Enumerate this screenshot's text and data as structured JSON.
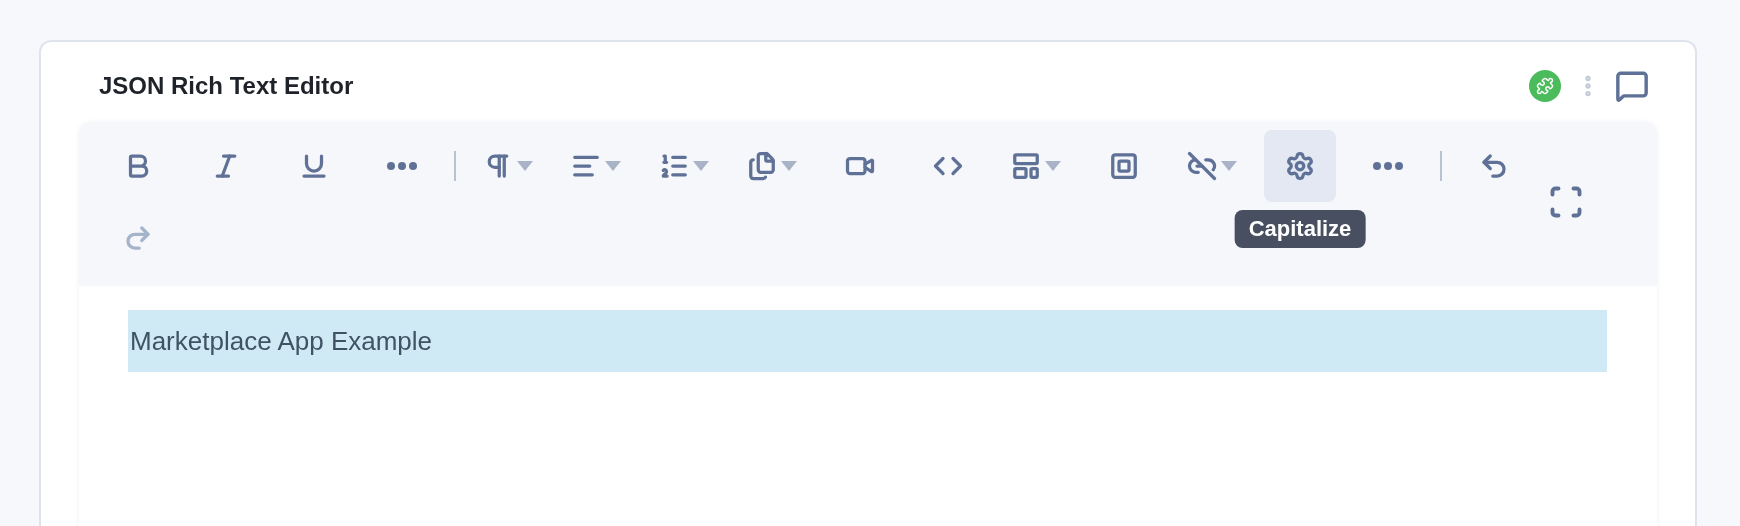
{
  "card": {
    "title": "JSON Rich Text Editor"
  },
  "header_actions": [
    {
      "kind": "status",
      "color": "#4cbb5c"
    },
    {
      "kind": "menu"
    },
    {
      "kind": "comment"
    }
  ],
  "toolbar": {
    "items": [
      {
        "kind": "button",
        "dropdown": false,
        "disabled": false,
        "hovered": false
      },
      {
        "kind": "button",
        "dropdown": false,
        "disabled": false,
        "hovered": false
      },
      {
        "kind": "button",
        "dropdown": false,
        "disabled": false,
        "hovered": false
      },
      {
        "kind": "button",
        "dropdown": false,
        "disabled": false,
        "hovered": false
      },
      {
        "kind": "divider"
      },
      {
        "kind": "button",
        "dropdown": true,
        "disabled": false,
        "hovered": false
      },
      {
        "kind": "button",
        "dropdown": true,
        "disabled": false,
        "hovered": false
      },
      {
        "kind": "button",
        "dropdown": true,
        "disabled": false,
        "hovered": false
      },
      {
        "kind": "button",
        "dropdown": true,
        "disabled": false,
        "hovered": false
      },
      {
        "kind": "button",
        "dropdown": false,
        "disabled": false,
        "hovered": false
      },
      {
        "kind": "button",
        "dropdown": false,
        "disabled": false,
        "hovered": false
      },
      {
        "kind": "button",
        "dropdown": true,
        "disabled": false,
        "hovered": false
      },
      {
        "kind": "button",
        "dropdown": false,
        "disabled": false,
        "hovered": false
      },
      {
        "kind": "button",
        "dropdown": true,
        "disabled": false,
        "hovered": false
      },
      {
        "kind": "button",
        "dropdown": false,
        "disabled": false,
        "hovered": true,
        "tooltip": "Capitalize"
      },
      {
        "kind": "button",
        "dropdown": false,
        "disabled": false,
        "hovered": false
      },
      {
        "kind": "divider"
      },
      {
        "kind": "button",
        "dropdown": false,
        "disabled": false,
        "hovered": false
      },
      {
        "kind": "button",
        "dropdown": false,
        "disabled": true,
        "hovered": false
      }
    ],
    "fullscreen": {
      "disabled": false
    }
  },
  "editor": {
    "paragraphs": [
      {
        "text": "Marketplace App Example",
        "selected": true
      }
    ]
  }
}
